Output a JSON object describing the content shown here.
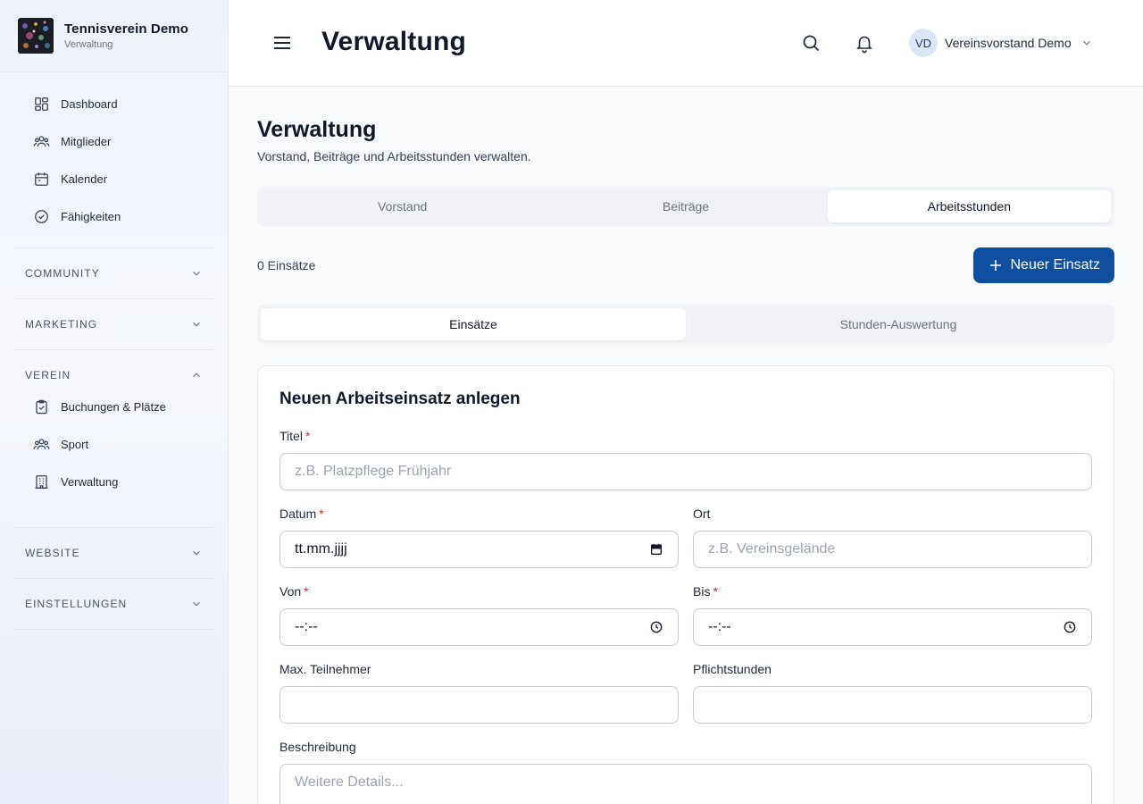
{
  "brand": {
    "name": "Tennisverein Demo",
    "subtitle": "Verwaltung"
  },
  "sidebar": {
    "top_items": [
      {
        "label": "Dashboard",
        "icon": "dashboard-icon"
      },
      {
        "label": "Mitglieder",
        "icon": "users-icon"
      },
      {
        "label": "Kalender",
        "icon": "calendar-icon"
      },
      {
        "label": "Fähigkeiten",
        "icon": "check-circle-icon"
      }
    ],
    "sections": [
      {
        "label": "COMMUNITY",
        "expanded": false
      },
      {
        "label": "MARKETING",
        "expanded": false
      },
      {
        "label": "VEREIN",
        "expanded": true,
        "items": [
          {
            "label": "Buchungen & Plätze",
            "icon": "clipboard-check-icon"
          },
          {
            "label": "Sport",
            "icon": "users-icon"
          },
          {
            "label": "Verwaltung",
            "icon": "building-icon"
          }
        ]
      },
      {
        "label": "WEBSITE",
        "expanded": false
      },
      {
        "label": "EINSTELLUNGEN",
        "expanded": false
      }
    ]
  },
  "topbar": {
    "title": "Verwaltung",
    "user": {
      "initials": "VD",
      "name": "Vereinsvorstand Demo"
    }
  },
  "page": {
    "title": "Verwaltung",
    "description": "Vorstand, Beiträge und Arbeitsstunden verwalten.",
    "tabs": [
      "Vorstand",
      "Beiträge",
      "Arbeitsstunden"
    ],
    "active_tab": "Arbeitsstunden",
    "count_text": "0 Einsätze",
    "new_button": "Neuer Einsatz",
    "subtabs": [
      "Einsätze",
      "Stunden-Auswertung"
    ],
    "active_subtab": "Einsätze"
  },
  "form": {
    "title": "Neuen Arbeitseinsatz anlegen",
    "titel": {
      "label": "Titel",
      "required": true,
      "placeholder": "z.B. Platzpflege Frühjahr"
    },
    "datum": {
      "label": "Datum",
      "required": true,
      "value": "tt.mm.jjjj"
    },
    "ort": {
      "label": "Ort",
      "required": false,
      "placeholder": "z.B. Vereinsgelände"
    },
    "von": {
      "label": "Von",
      "required": true,
      "value": "--:--"
    },
    "bis": {
      "label": "Bis",
      "required": true,
      "value": "--:--"
    },
    "max_teilnehmer": {
      "label": "Max. Teilnehmer",
      "required": false,
      "value": ""
    },
    "pflichtstunden": {
      "label": "Pflichtstunden",
      "required": false,
      "value": ""
    },
    "beschreibung": {
      "label": "Beschreibung",
      "required": false,
      "placeholder": "Weitere Details..."
    }
  },
  "colors": {
    "primary": "#0e4fa0",
    "required": "#dc2626",
    "avatar_bg": "#dbe7f7"
  }
}
